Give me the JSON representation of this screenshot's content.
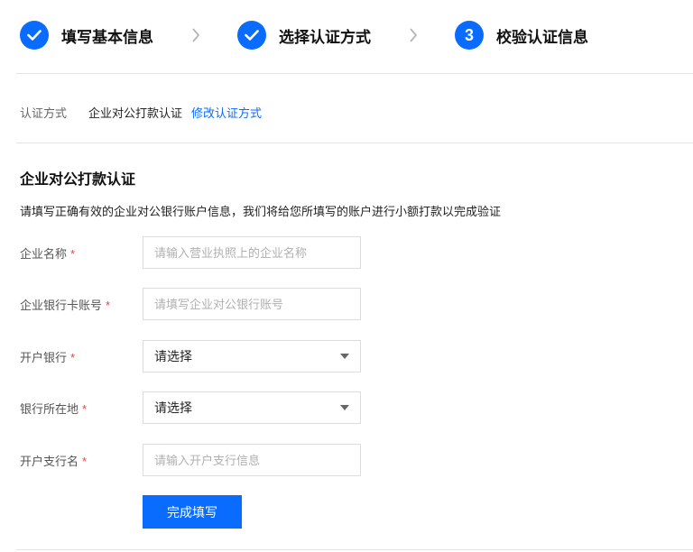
{
  "steps": [
    {
      "label": "填写基本信息",
      "state": "done",
      "icon": "check-icon"
    },
    {
      "label": "选择认证方式",
      "state": "done",
      "icon": "check-icon"
    },
    {
      "label": "校验认证信息",
      "state": "current",
      "number": "3"
    }
  ],
  "method": {
    "label": "认证方式",
    "value": "企业对公打款认证",
    "change_link": "修改认证方式"
  },
  "section": {
    "title": "企业对公打款认证",
    "description": "请填写正确有效的企业对公银行账户信息，我们将给您所填写的账户进行小额打款以完成验证"
  },
  "form": {
    "required_mark": "*",
    "company_name": {
      "label": "企业名称",
      "placeholder": "请输入营业执照上的企业名称",
      "value": ""
    },
    "bank_account": {
      "label": "企业银行卡账号",
      "placeholder": "请填写企业对公银行账号",
      "value": ""
    },
    "bank": {
      "label": "开户银行",
      "selected": "请选择"
    },
    "bank_location": {
      "label": "银行所在地",
      "selected": "请选择"
    },
    "branch_name": {
      "label": "开户支行名",
      "placeholder": "请输入开户支行信息",
      "value": ""
    },
    "submit_label": "完成填写"
  },
  "colors": {
    "accent": "#0a6cff",
    "required": "#e54545",
    "border": "#dcdcdc"
  }
}
